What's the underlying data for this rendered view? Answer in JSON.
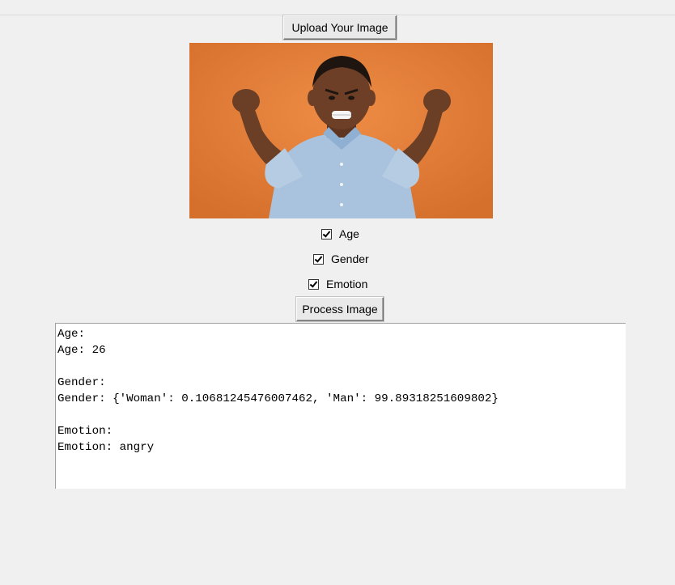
{
  "window": {
    "upload_button": "Upload Your Image",
    "process_button": "Process Image"
  },
  "image": {
    "description_icon": "child-photo",
    "background_color": "#e07a35"
  },
  "options": [
    {
      "label": "Age",
      "checked": true
    },
    {
      "label": "Gender",
      "checked": true
    },
    {
      "label": "Emotion",
      "checked": true
    }
  ],
  "output": {
    "lines": [
      "Age:",
      "Age: 26",
      "",
      "Gender:",
      "Gender: {'Woman': 0.10681245476007462, 'Man': 99.89318251609802}",
      "",
      "Emotion:",
      "Emotion: angry"
    ]
  }
}
